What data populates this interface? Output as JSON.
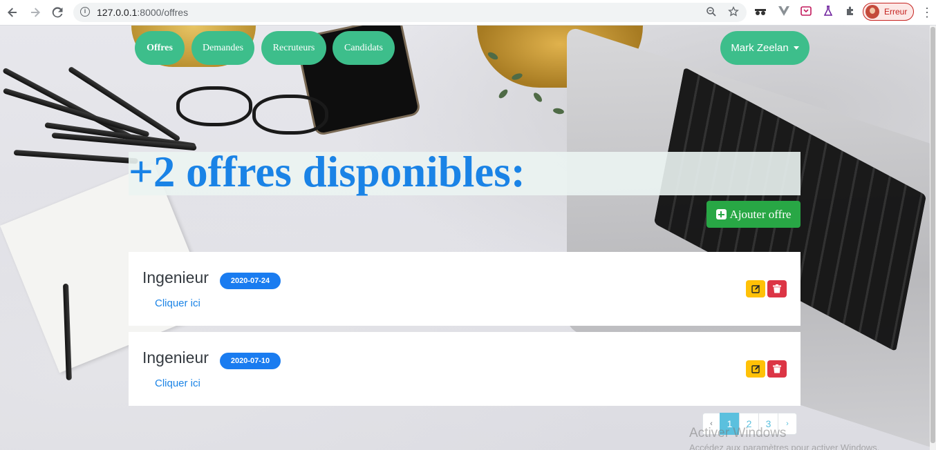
{
  "browser": {
    "url_host": "127.0.0.1",
    "url_path": ":8000/offres",
    "profile_label": "Erreur"
  },
  "nav": {
    "items": [
      {
        "label": "Offres",
        "active": true
      },
      {
        "label": "Demandes",
        "active": false
      },
      {
        "label": "Recruteurs",
        "active": false
      },
      {
        "label": "Candidats",
        "active": false
      }
    ],
    "user": "Mark Zeelan"
  },
  "main": {
    "heading": "+2 offres disponibles:",
    "add_button": "Ajouter offre",
    "offers": [
      {
        "title": "Ingenieur",
        "date": "2020-07-24",
        "link": "Cliquer ici"
      },
      {
        "title": "Ingenieur",
        "date": "2020-07-10",
        "link": "Cliquer ici"
      }
    ]
  },
  "pagination": {
    "prev": "‹",
    "pages": [
      "1",
      "2",
      "3"
    ],
    "active_page": "1",
    "next": "›"
  },
  "watermark": {
    "line1": "Activer Windows",
    "line2": "Accédez aux paramètres pour activer Windows."
  },
  "colors": {
    "nav_green": "#3dbe8b",
    "heading_blue": "#1a83e6",
    "add_green": "#28a745",
    "badge_blue": "#1a7cf0",
    "edit_yellow": "#ffc107",
    "delete_red": "#dc3545",
    "pager_cyan": "#5bc0de"
  }
}
